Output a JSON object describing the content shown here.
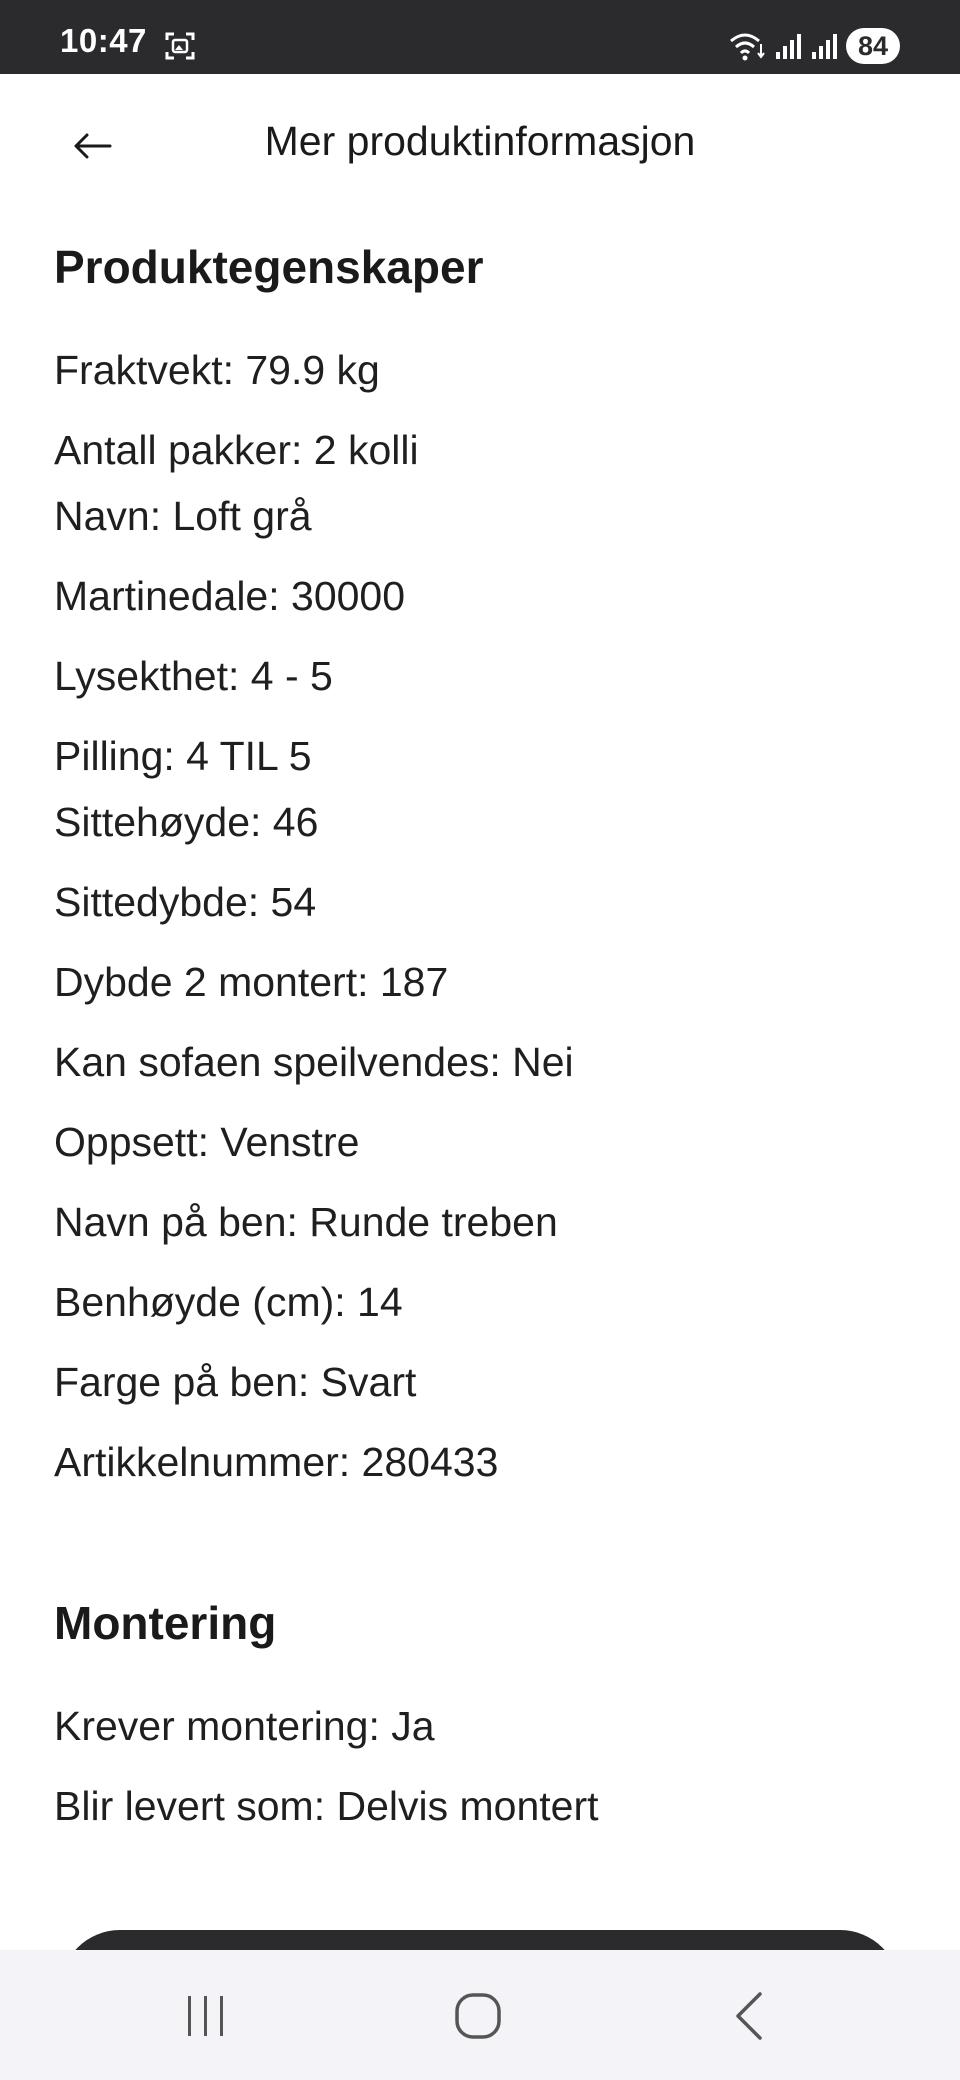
{
  "status_bar": {
    "time": "10:47",
    "battery": "84",
    "icons": [
      "screenshot-icon",
      "wifi-icon",
      "signal-icon",
      "signal-icon"
    ]
  },
  "header": {
    "title": "Mer produktinformasjon",
    "back_icon": "arrow-left-icon"
  },
  "sections": [
    {
      "heading": "Produktegenskaper",
      "items": [
        "Fraktvekt: 79.9 kg",
        "Antall pakker: 2 kolli",
        "Navn: Loft grå",
        "Martinedale: 30000",
        "Lysekthet: 4 - 5",
        "Pilling: 4 TIL 5",
        "Sittehøyde: 46",
        "Sittedybde: 54",
        "Dybde 2 montert: 187",
        "Kan sofaen speilvendes: Nei",
        "Oppsett: Venstre",
        "Navn på ben: Runde treben",
        "Benhøyde (cm): 14",
        "Farge på ben: Svart",
        "Artikkelnummer: 280433"
      ]
    },
    {
      "heading": "Montering",
      "items": [
        "Krever montering: Ja",
        "Blir levert som: Delvis montert"
      ]
    }
  ],
  "nav_bar": {
    "icons": [
      "recent-apps-icon",
      "home-icon",
      "back-icon"
    ]
  },
  "colors": {
    "status_bar": "#2b2b2e",
    "text": "#1f1f1f",
    "nav_bar": "#f3f3f8",
    "background": "#ffffff"
  }
}
